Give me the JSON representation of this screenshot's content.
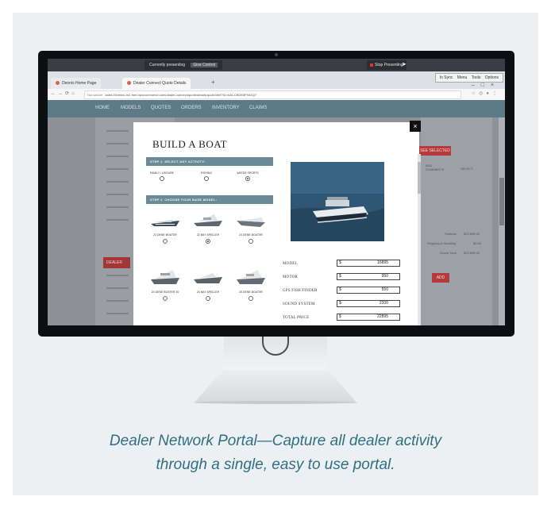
{
  "caption": {
    "line1": "Dealer Network Portal—Capture all dealer activity",
    "line2": "through a single, easy to use portal."
  },
  "share_bar": {
    "presenting_label": "Currently presenting",
    "control_label": "Give Control",
    "stop_label": "Stop Presenting"
  },
  "window_controls": [
    "In Sync",
    "Menu",
    "Tools",
    "Options"
  ],
  "browser": {
    "tabs": [
      {
        "label": "Dennis Home Page",
        "active": false
      },
      {
        "label": "Dealer Connect Quote Details",
        "active": true
      }
    ],
    "url_security": "Not secure",
    "url": "sales.h3demo-m2-free.epiccommerce.com/dealer-connect/quote/details/quote/4bf/?ID=6ACCBDE8F90AQ7",
    "nav_icons": [
      "back-icon",
      "forward-icon",
      "reload-icon",
      "home-icon"
    ]
  },
  "site_nav": {
    "items": [
      "HOME",
      "MODELS",
      "QUOTES",
      "ORDERS",
      "INVENTORY",
      "CLAIMS"
    ]
  },
  "background_page": {
    "dealer_label": "DEALER",
    "right_button": "SEE SELECTED",
    "col_comments": "ADD COMMENTS",
    "col_select": "SELECT",
    "subtotal_label": "Subtotal",
    "subtotal_value": "$22,895.00",
    "shipping_label": "Shipping & Handling",
    "shipping_value": "$0.00",
    "grand_label": "Grand Total",
    "grand_value": "$22,895.00",
    "add_button": "ADD"
  },
  "modal": {
    "title": "BUILD A BOAT",
    "close_label": "×",
    "step1": "STEP 1. SELECT ANY ACTIVITY:",
    "activities": [
      {
        "label": "FAMILY / LEISURE",
        "selected": false
      },
      {
        "label": "FISHING",
        "selected": false
      },
      {
        "label": "WATER SPORTS",
        "selected": true
      }
    ],
    "step2": "STEP 2. CHOOSE YOUR BASE MODEL:",
    "models": [
      {
        "label": "22 DENE BOATER",
        "selected": false
      },
      {
        "label": "22 BAY SPELLER",
        "selected": true
      },
      {
        "label": "24 DENE BOATER",
        "selected": false
      },
      {
        "label": "24 DENE BOATER 30",
        "selected": false
      },
      {
        "label": "24 BAY SPELLER",
        "selected": false
      },
      {
        "label": "26 DENE BOATER",
        "selected": false
      }
    ],
    "price_rows": [
      {
        "label": "MODEL",
        "currency": "$",
        "value": "16895"
      },
      {
        "label": "MOTOR",
        "currency": "$",
        "value": "950"
      },
      {
        "label": "GPS FISH FINDER",
        "currency": "$",
        "value": "550"
      },
      {
        "label": "SOUND SYSTEM",
        "currency": "$",
        "value": "2200"
      },
      {
        "label": "TOTAL PRICE",
        "currency": "$",
        "value": "22895"
      }
    ]
  }
}
